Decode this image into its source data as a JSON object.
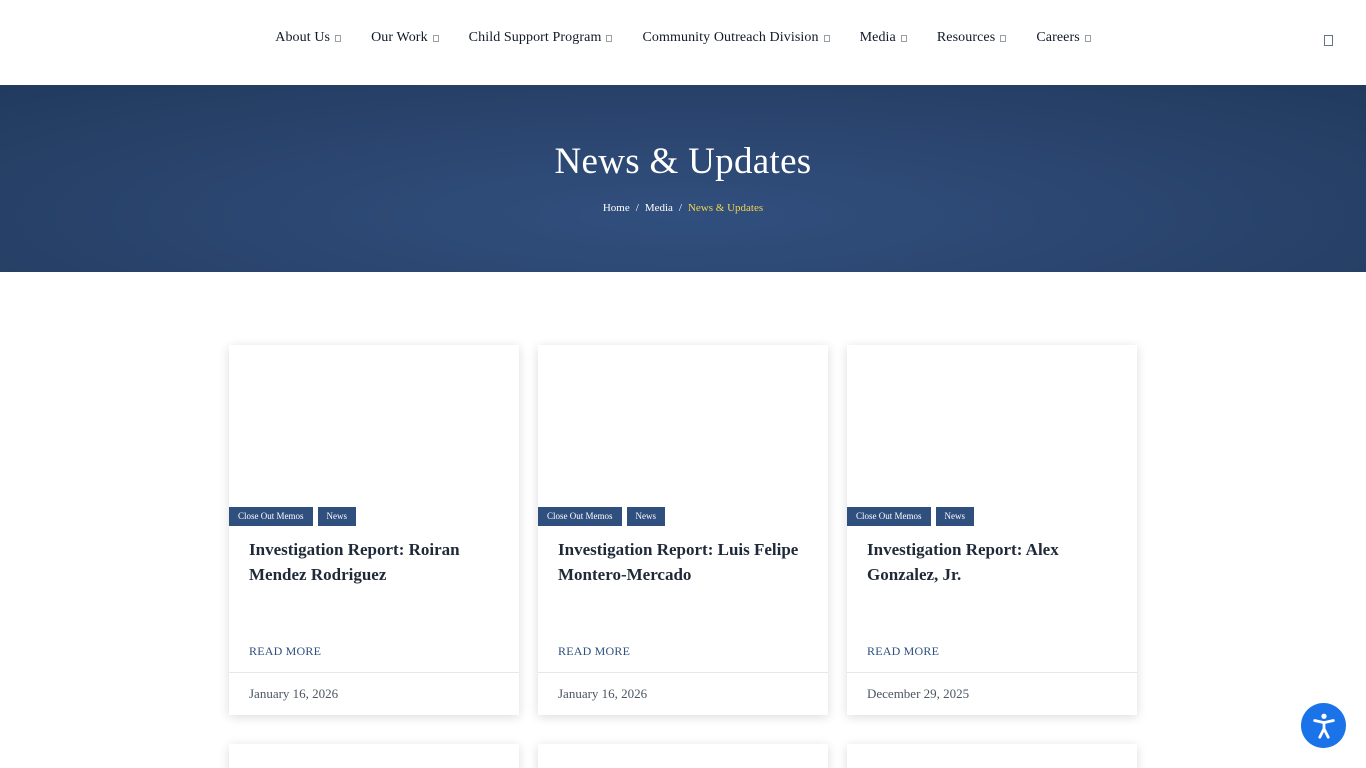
{
  "nav": {
    "items": [
      {
        "label": "About Us"
      },
      {
        "label": "Our Work"
      },
      {
        "label": "Child Support Program"
      },
      {
        "label": "Community Outreach Division"
      },
      {
        "label": "Media"
      },
      {
        "label": "Resources"
      },
      {
        "label": "Careers"
      }
    ]
  },
  "hero": {
    "title": "News & Updates",
    "breadcrumb": {
      "home": "Home",
      "media": "Media",
      "current": "News & Updates",
      "separator": "/"
    }
  },
  "cards": [
    {
      "tags": [
        "Close Out Memos",
        "News"
      ],
      "title": "Investigation Report: Roiran Mendez Rodriguez",
      "read_more": "READ MORE",
      "date": "January 16, 2026"
    },
    {
      "tags": [
        "Close Out Memos",
        "News"
      ],
      "title": "Investigation Report: Luis Felipe Montero-Mercado",
      "read_more": "READ MORE",
      "date": "January 16, 2026"
    },
    {
      "tags": [
        "Close Out Memos",
        "News"
      ],
      "title": "Investigation Report: Alex Gonzalez, Jr.",
      "read_more": "READ MORE",
      "date": "December 29, 2025"
    }
  ],
  "colors": {
    "hero_bg": "#2b4670",
    "tag_bg": "#2f4f7f",
    "breadcrumb_current": "#f2d44e",
    "a11y_button": "#1a73e8"
  },
  "icons": {
    "search": "search-icon",
    "dropdown": "chevron-down-icon",
    "accessibility": "accessibility-icon"
  }
}
